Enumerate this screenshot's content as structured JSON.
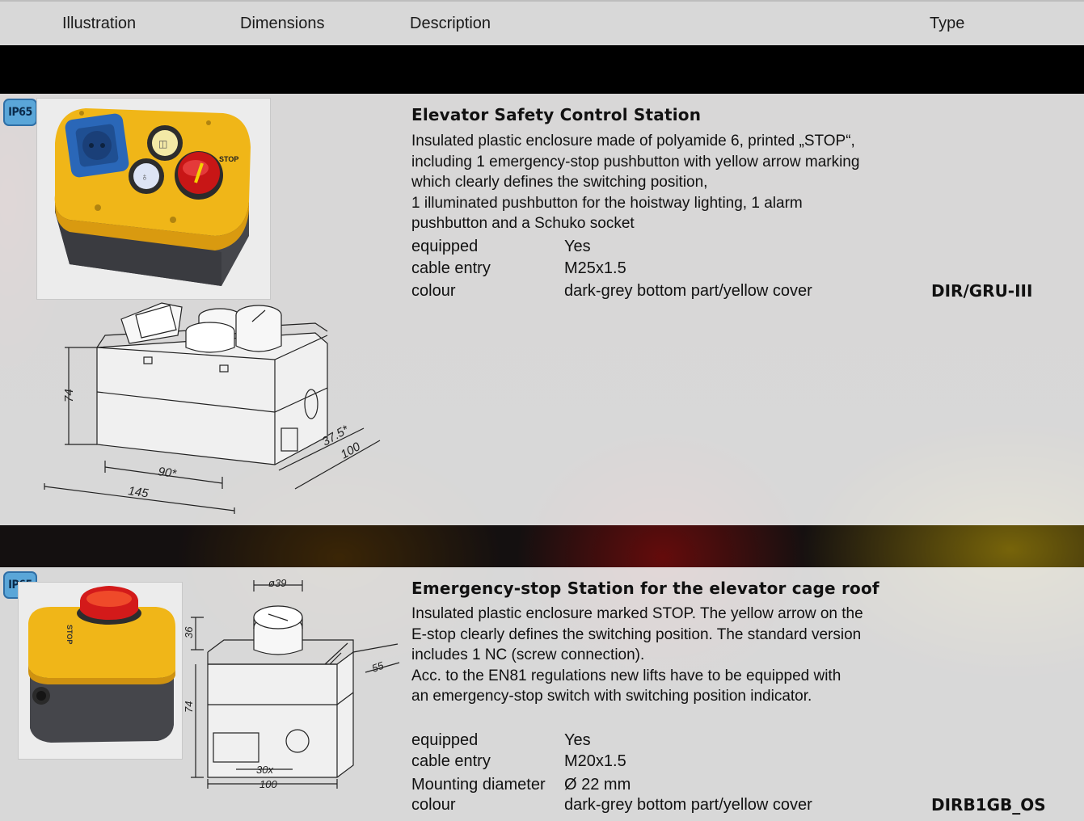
{
  "header": {
    "col_illustration": "Illustration",
    "col_dimensions": "Dimensions",
    "col_description": "Description",
    "col_type": "Type"
  },
  "products": [
    {
      "badge": "IP65",
      "title": "Elevator Safety Control Station",
      "description_lines": [
        "Insulated plastic enclosure made of polyamide 6, printed „STOP“,",
        "including 1 emergency-stop pushbutton with yellow arrow marking",
        "which clearly defines the switching position,",
        "1 illuminated pushbutton for the hoistway lighting, 1 alarm",
        "pushbutton and a Schuko socket"
      ],
      "specs": [
        {
          "label": "equipped",
          "value": "Yes"
        },
        {
          "label": "cable entry",
          "value": "M25x1.5"
        },
        {
          "label": "colour",
          "value": "dark-grey bottom part/yellow cover"
        }
      ],
      "type_code": "DIR/GRU-III",
      "dims": {
        "height": "74",
        "width_inner": "90*",
        "width": "145",
        "depth_inner": "37.5*",
        "depth": "100"
      },
      "stop_marking": "STOP"
    },
    {
      "badge": "IP65",
      "title": "Emergency-stop Station for the elevator cage roof",
      "description_lines": [
        "Insulated plastic enclosure marked STOP. The yellow arrow on the",
        "E-stop clearly defines the switching position. The standard version",
        "includes 1 NC (screw connection).",
        "Acc. to the EN81 regulations new lifts have to be equipped with",
        "an emergency-stop switch with switching position indicator."
      ],
      "specs": [
        {
          "label": "equipped",
          "value": "Yes"
        },
        {
          "label": "cable entry",
          "value": "M20x1.5"
        },
        {
          "label": "Mounting diameter",
          "value": "Ø 22 mm"
        },
        {
          "label": "colour",
          "value": "dark-grey bottom part/yellow cover"
        }
      ],
      "type_code": "DIRB1GB_OS",
      "dims": {
        "diameter": "ø39",
        "top_height": "36",
        "height": "74",
        "depth": "55",
        "width_inner": "30x",
        "width": "100"
      },
      "stop_marking": "STOP"
    }
  ],
  "colors": {
    "yellow": "#f2c21a",
    "dark_grey": "#3c3c40",
    "red": "#d71a1a",
    "blue": "#2a67b8",
    "badge": "#5aa6d8"
  }
}
